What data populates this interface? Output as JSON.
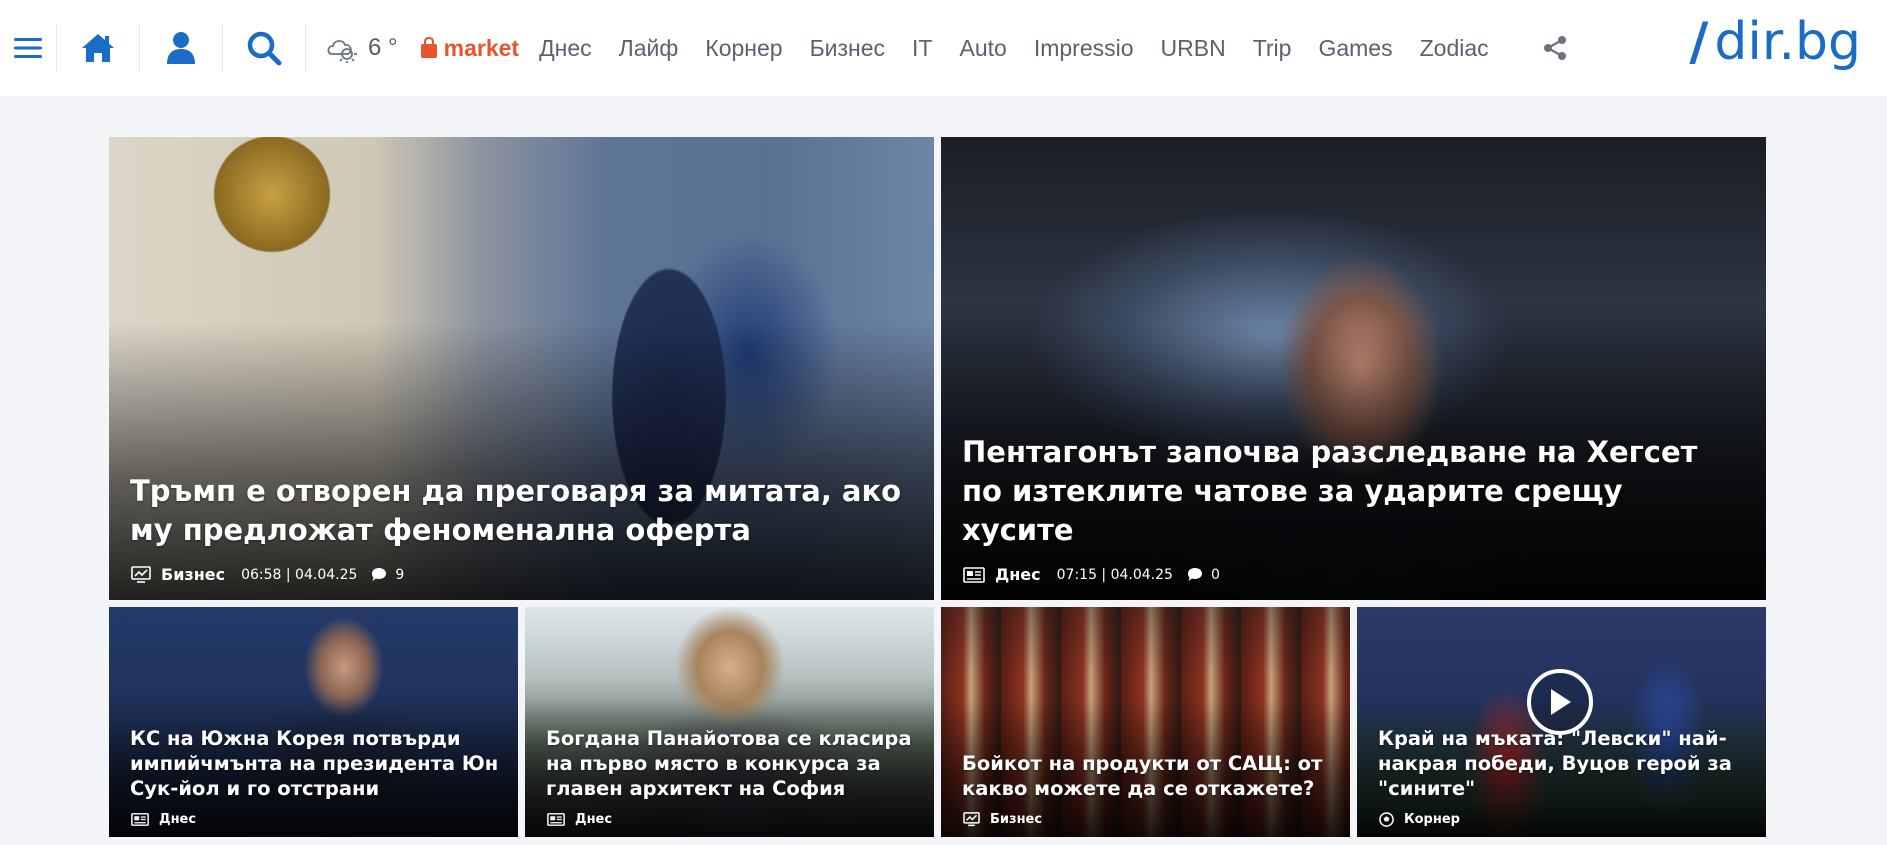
{
  "header": {
    "weather_temp": "6 °",
    "market_label": "market",
    "nav": [
      "Днес",
      "Лайф",
      "Корнер",
      "Бизнес",
      "IT",
      "Auto",
      "Impressio",
      "URBN",
      "Trip",
      "Games",
      "Zodiac"
    ],
    "logo_slash": "/",
    "logo_text": "dir.bg"
  },
  "articles": {
    "main": [
      {
        "title": "Тръмп е отворен да преговаря за митата, ако му предложат феноменална оферта",
        "category": "Бизнес",
        "time": "06:58 | 04.04.25",
        "comments": "9"
      },
      {
        "title": "Пентагонът започва разследване на Хегсет по изтеклите чатове за ударите срещу хуситe",
        "category": "Днес",
        "time": "07:15 | 04.04.25",
        "comments": "0"
      }
    ],
    "secondary": [
      {
        "title": "КС на Южна Корея потвърди импийчмънта на президента Юн Сук-йол и го отстрани",
        "category": "Днес"
      },
      {
        "title": "Богдана Панайотова се класира на първо място в конкурса за главен архитект на София",
        "category": "Днес"
      },
      {
        "title": "Бойкот на продукти от САЩ: от какво можете да се откажете?",
        "category": "Бизнес"
      },
      {
        "title": "Край на мъката: \"Левски\" най-накрая победи, Вуцов герой за \"сините\"",
        "category": "Корнер"
      }
    ]
  },
  "colors": {
    "accent": "#1a6cc4",
    "market": "#e8542c",
    "nav_text": "#5a6270",
    "background": "#f4f5f9"
  },
  "icons": [
    "menu-icon",
    "home-icon",
    "user-icon",
    "search-icon",
    "weather-icon",
    "shopping-bag-icon",
    "share-icon",
    "chart-icon",
    "newspaper-icon",
    "comment-icon",
    "soccer-ball-icon",
    "play-icon"
  ]
}
